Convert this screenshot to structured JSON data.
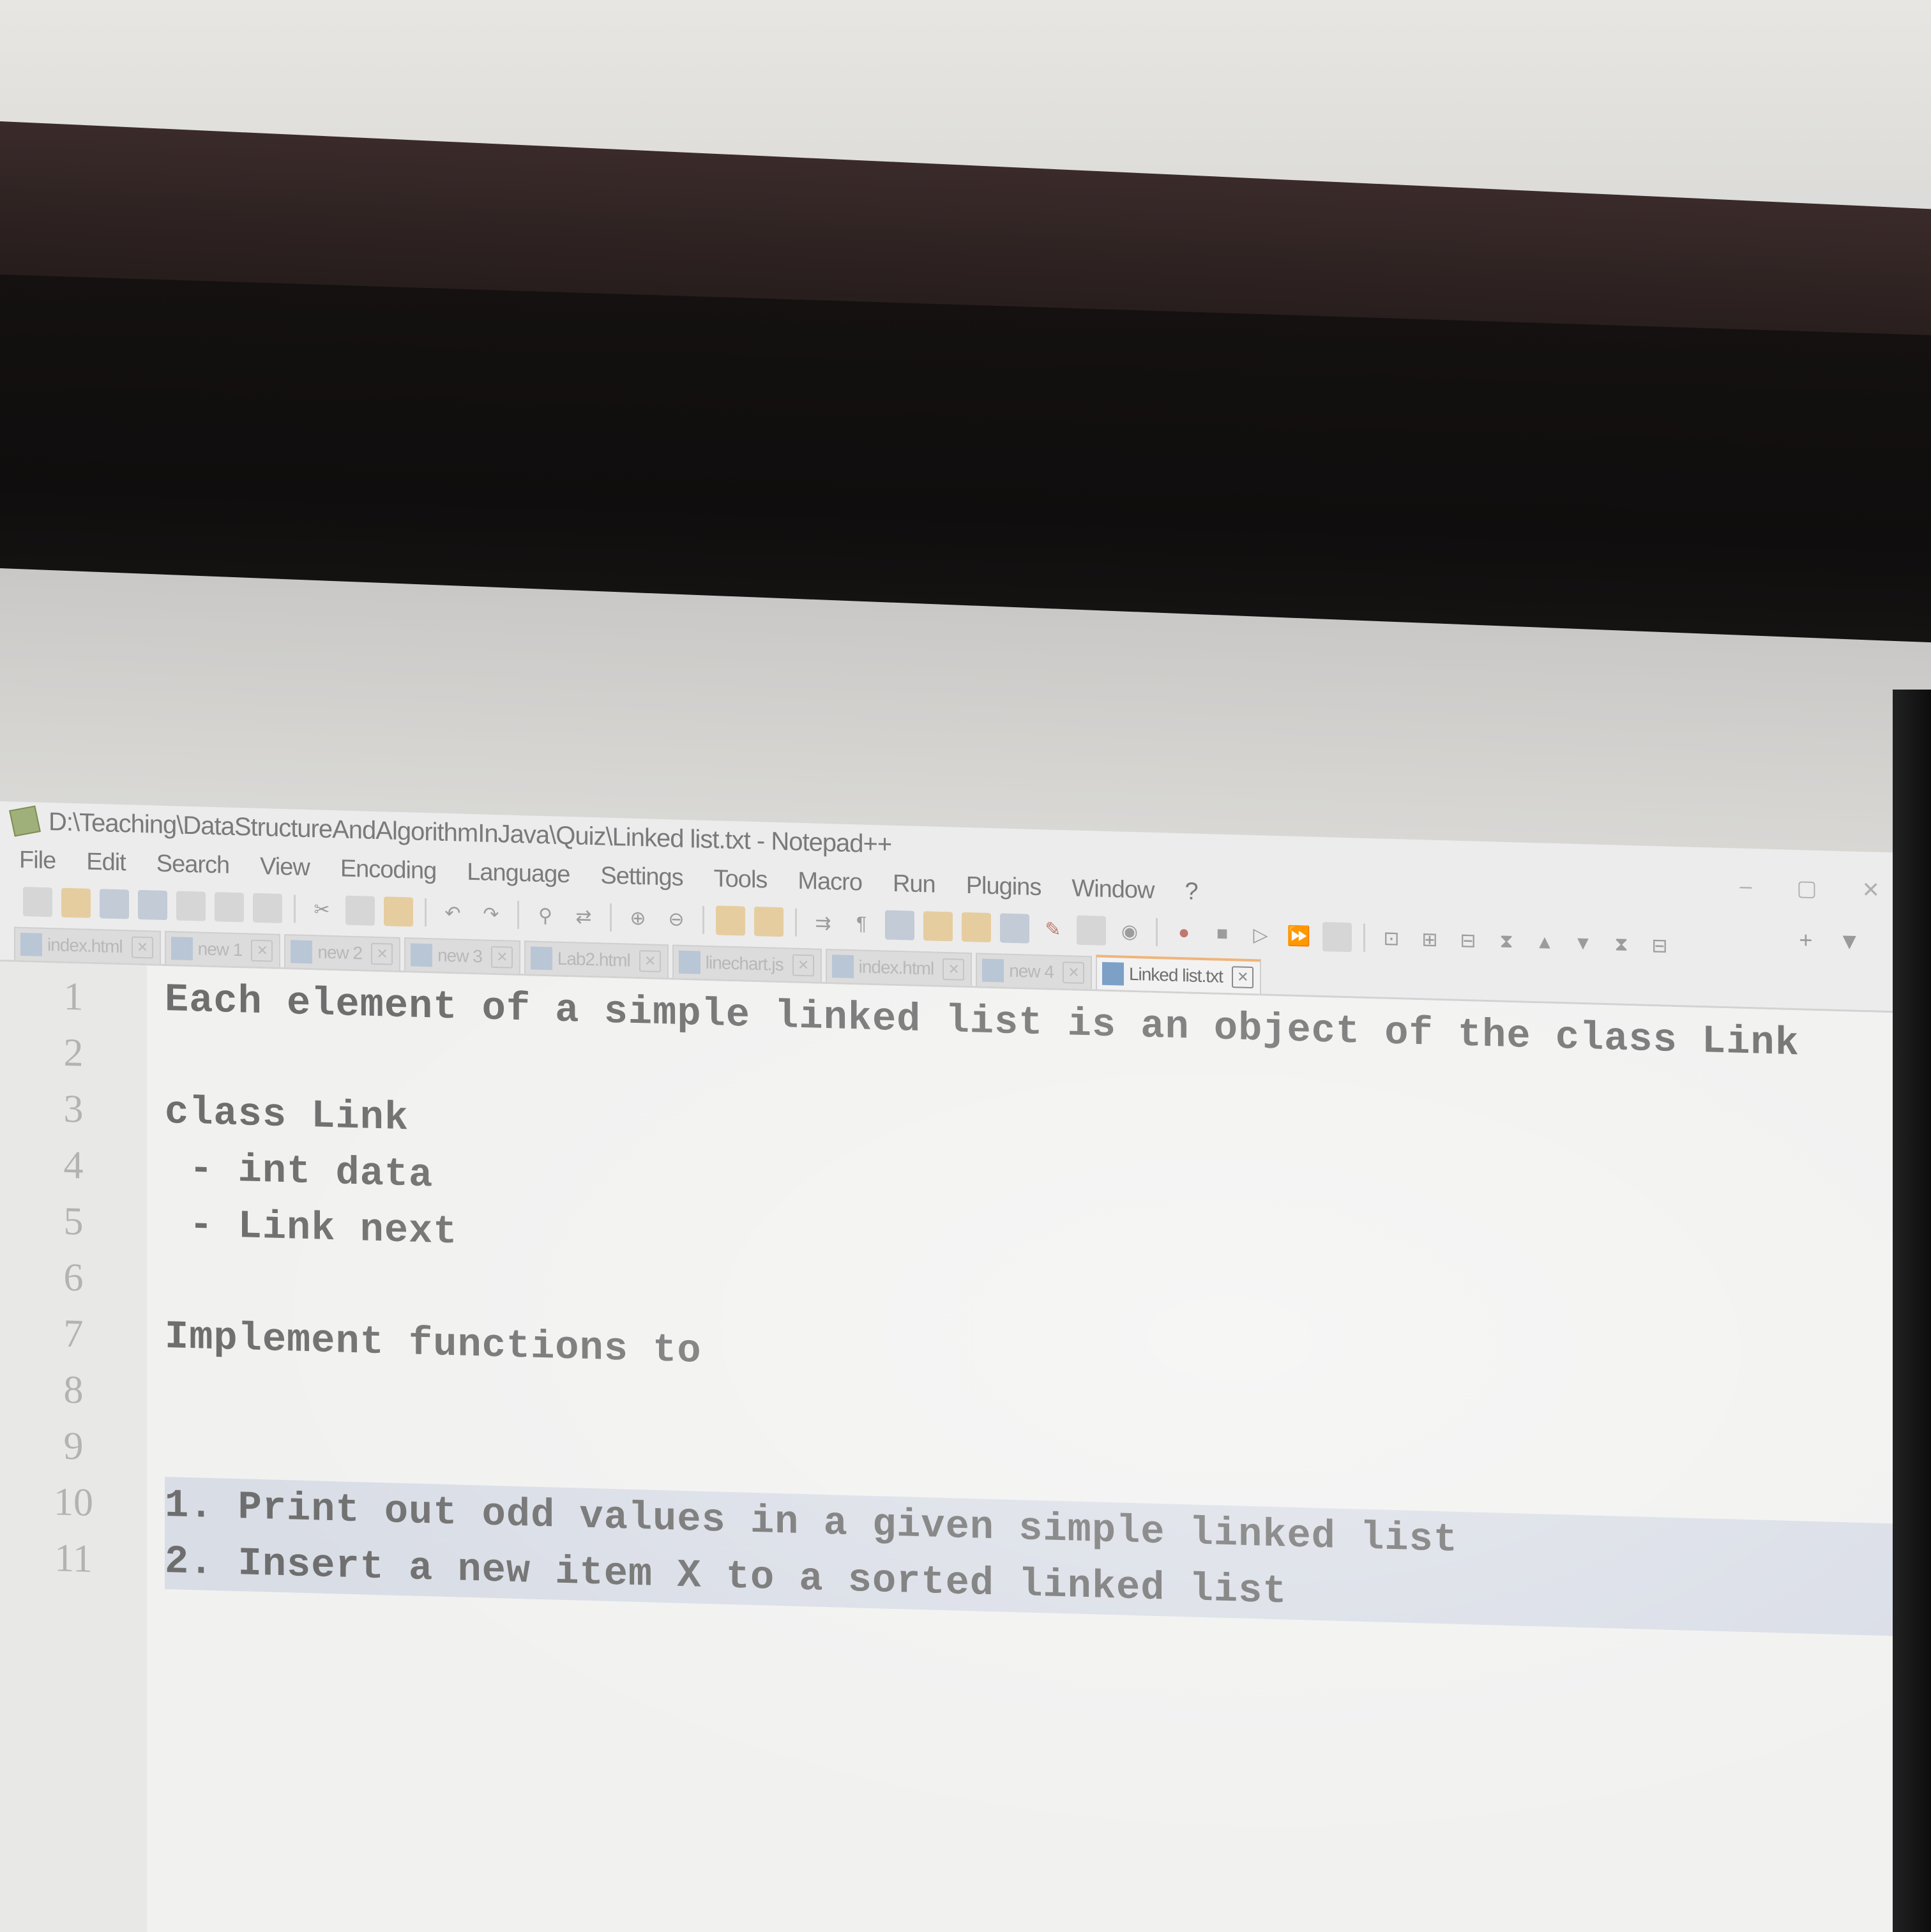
{
  "window": {
    "title": "D:\\Teaching\\DataStructureAndAlgorithmInJava\\Quiz\\Linked list.txt - Notepad++"
  },
  "menu": [
    {
      "label": "File"
    },
    {
      "label": "Edit"
    },
    {
      "label": "Search"
    },
    {
      "label": "View"
    },
    {
      "label": "Encoding"
    },
    {
      "label": "Language"
    },
    {
      "label": "Settings"
    },
    {
      "label": "Tools"
    },
    {
      "label": "Macro"
    },
    {
      "label": "Run"
    },
    {
      "label": "Plugins"
    },
    {
      "label": "Window"
    },
    {
      "label": "?"
    }
  ],
  "menu_right": {
    "plus": "+",
    "dropdown": "▼"
  },
  "tabs": [
    {
      "label": "index.html",
      "active": false
    },
    {
      "label": "new 1",
      "active": false
    },
    {
      "label": "new 2",
      "active": false
    },
    {
      "label": "new 3",
      "active": false
    },
    {
      "label": "Lab2.html",
      "active": false
    },
    {
      "label": "linechart.js",
      "active": false
    },
    {
      "label": "index.html",
      "active": false
    },
    {
      "label": "new 4",
      "active": false
    },
    {
      "label": "Linked list.txt",
      "active": true
    }
  ],
  "editor": {
    "lines": [
      {
        "number": "1",
        "text": "Each element of a simple linked list is an object of the class Link",
        "selected": false
      },
      {
        "number": "2",
        "text": "",
        "selected": false
      },
      {
        "number": "3",
        "text": "class Link",
        "selected": false
      },
      {
        "number": "4",
        "text": " - int data",
        "selected": false
      },
      {
        "number": "5",
        "text": " - Link next",
        "selected": false
      },
      {
        "number": "6",
        "text": "",
        "selected": false
      },
      {
        "number": "7",
        "text": "Implement functions to",
        "selected": false
      },
      {
        "number": "8",
        "text": "",
        "selected": false
      },
      {
        "number": "9",
        "text": "",
        "selected": false
      },
      {
        "number": "10",
        "text": "1. Print out odd values in a given simple linked list",
        "selected": true
      },
      {
        "number": "11",
        "text": "2. Insert a new item X to a sorted linked list",
        "selected": true
      }
    ]
  },
  "colors": {
    "active_tab_accent": "#efb47a",
    "selection": "#d9dde6"
  }
}
